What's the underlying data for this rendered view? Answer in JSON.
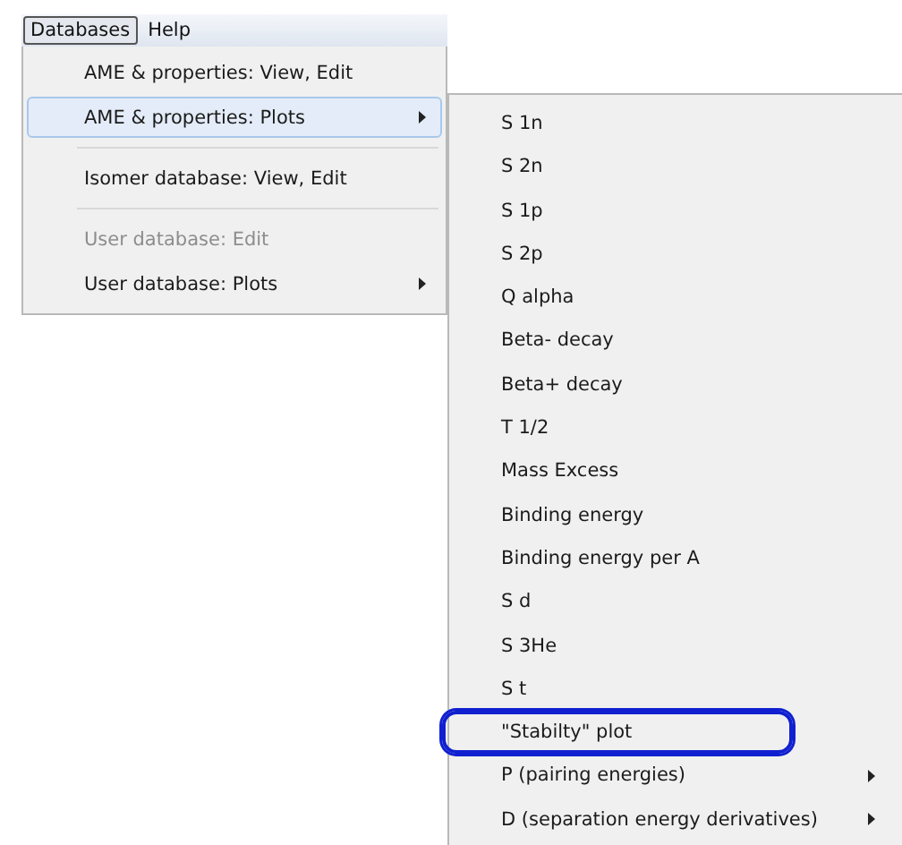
{
  "menubar": [
    {
      "label": "Databases",
      "selected": true
    },
    {
      "label": "Help",
      "selected": false
    }
  ],
  "menu": {
    "items": [
      {
        "kind": "item",
        "label": "AME & properties: View, Edit",
        "selected": false,
        "disabled": false,
        "submenu": false
      },
      {
        "kind": "item",
        "label": "AME & properties: Plots",
        "selected": true,
        "disabled": false,
        "submenu": true
      },
      {
        "kind": "separator"
      },
      {
        "kind": "item",
        "label": "Isomer database: View, Edit",
        "selected": false,
        "disabled": false,
        "submenu": false
      },
      {
        "kind": "separator"
      },
      {
        "kind": "item",
        "label": "User database: Edit",
        "selected": false,
        "disabled": true,
        "submenu": false
      },
      {
        "kind": "item",
        "label": "User database: Plots",
        "selected": false,
        "disabled": false,
        "submenu": true
      }
    ]
  },
  "submenu": {
    "items": [
      {
        "label": "S 1n",
        "submenu": false,
        "circled": false
      },
      {
        "label": "S 2n",
        "submenu": false,
        "circled": false
      },
      {
        "label": "S 1p",
        "submenu": false,
        "circled": false
      },
      {
        "label": "S 2p",
        "submenu": false,
        "circled": false
      },
      {
        "label": "Q alpha",
        "submenu": false,
        "circled": false
      },
      {
        "label": "Beta- decay",
        "submenu": false,
        "circled": false
      },
      {
        "label": "Beta+ decay",
        "submenu": false,
        "circled": false
      },
      {
        "label": "T 1/2",
        "submenu": false,
        "circled": false
      },
      {
        "label": "Mass Excess",
        "submenu": false,
        "circled": false
      },
      {
        "label": "Binding energy",
        "submenu": false,
        "circled": false
      },
      {
        "label": "Binding energy per A",
        "submenu": false,
        "circled": false
      },
      {
        "label": "S d",
        "submenu": false,
        "circled": false
      },
      {
        "label": "S 3He",
        "submenu": false,
        "circled": false
      },
      {
        "label": "S t",
        "submenu": false,
        "circled": false
      },
      {
        "label": "\"Stabilty\" plot",
        "submenu": false,
        "circled": true
      },
      {
        "label": "P (pairing energies)",
        "submenu": true,
        "circled": false
      },
      {
        "label": "D (separation energy derivatives)",
        "submenu": true,
        "circled": false
      }
    ]
  }
}
